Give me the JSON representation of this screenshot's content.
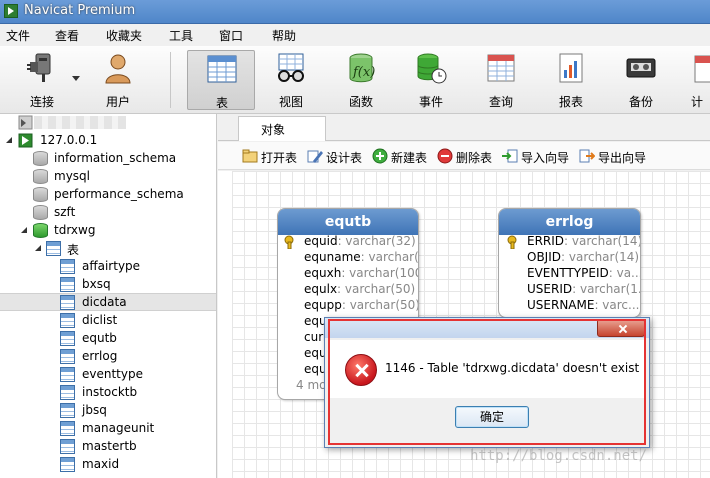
{
  "window": {
    "title": "Navicat Premium"
  },
  "menu": [
    "文件",
    "查看",
    "收藏夹",
    "工具",
    "窗口",
    "帮助"
  ],
  "toolbar": {
    "buttons": [
      {
        "label": "连接",
        "icon": "plug-icon"
      },
      {
        "label": "用户",
        "icon": "user-icon"
      },
      {
        "label": "表",
        "icon": "table-icon",
        "active": true
      },
      {
        "label": "视图",
        "icon": "glasses-icon"
      },
      {
        "label": "函数",
        "icon": "function-icon"
      },
      {
        "label": "事件",
        "icon": "event-clock-icon"
      },
      {
        "label": "查询",
        "icon": "query-icon"
      },
      {
        "label": "报表",
        "icon": "report-icon"
      },
      {
        "label": "备份",
        "icon": "backup-tape-icon"
      },
      {
        "label": "计",
        "icon": "schedule-icon"
      }
    ]
  },
  "tree": {
    "connection": "127.0.0.1",
    "databases": [
      "information_schema",
      "mysql",
      "performance_schema",
      "szft",
      "tdrxwg"
    ],
    "tables_group": "表",
    "tables": [
      "affairtype",
      "bxsq",
      "dicdata",
      "diclist",
      "equtb",
      "errlog",
      "eventtype",
      "instocktb",
      "jbsq",
      "manageunit",
      "mastertb",
      "maxid"
    ],
    "selected_table": "dicdata"
  },
  "tabs": {
    "objects": "对象"
  },
  "object_toolbar": [
    "打开表",
    "设计表",
    "新建表",
    "删除表",
    "导入向导",
    "导出向导"
  ],
  "er": {
    "equtb": {
      "name": "equtb",
      "fields": [
        {
          "name": "equid",
          "type": ": varchar(32)",
          "key": true
        },
        {
          "name": "equname",
          "type": ": varchar(...",
          "key": false
        },
        {
          "name": "equxh",
          "type": ": varchar(100)",
          "key": false
        },
        {
          "name": "equlx",
          "type": ": varchar(50)",
          "key": false
        },
        {
          "name": "equpp",
          "type": ": varchar(50)",
          "key": false
        },
        {
          "name": "equ",
          "type": "",
          "key": false
        },
        {
          "name": "curr",
          "type": "",
          "key": false
        },
        {
          "name": "equ",
          "type": "",
          "key": false
        },
        {
          "name": "equ",
          "type": "",
          "key": false
        }
      ],
      "more": "4 mo"
    },
    "errlog": {
      "name": "errlog",
      "fields": [
        {
          "name": "ERRID",
          "type": ": varchar(14)",
          "key": true
        },
        {
          "name": "OBJID",
          "type": ": varchar(14)",
          "key": false
        },
        {
          "name": "EVENTTYPEID",
          "type": ": va...",
          "key": false
        },
        {
          "name": "USERID",
          "type": ": varchar(1...",
          "key": false
        },
        {
          "name": "USERNAME",
          "type": ": varc...",
          "key": false
        }
      ]
    }
  },
  "dialog": {
    "message": "1146 - Table 'tdrxwg.dicdata' doesn't exist",
    "ok_label": "确定"
  },
  "watermark": "http://blog.csdn.net/"
}
